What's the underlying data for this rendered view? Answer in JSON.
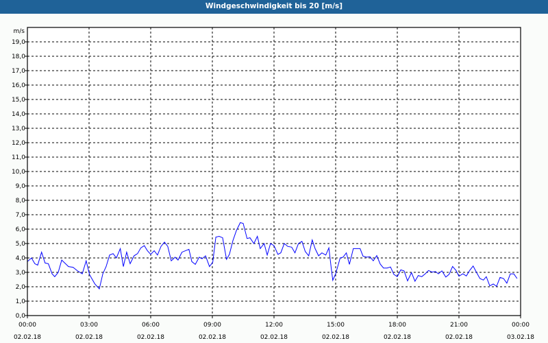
{
  "title": "Windgeschwindigkeit bis 20 [m/s]",
  "colors": {
    "titlebar": "#1f6298",
    "line": "#0000ff"
  },
  "chart_data": {
    "type": "line",
    "title": "Windgeschwindigkeit bis 20 [m/s]",
    "ylabel": "m/s",
    "xlabel": "",
    "ylim": [
      0,
      20
    ],
    "xlim_hours": [
      0,
      24
    ],
    "grid": true,
    "y_ticks": [
      "0,0",
      "1,0",
      "2,0",
      "3,0",
      "4,0",
      "5,0",
      "6,0",
      "7,0",
      "8,0",
      "9,0",
      "10,0",
      "11,0",
      "12,0",
      "13,0",
      "14,0",
      "15,0",
      "16,0",
      "17,0",
      "18,0",
      "19,0"
    ],
    "x_ticks": [
      {
        "time": "00:00",
        "date": "02.02.18"
      },
      {
        "time": "03:00",
        "date": "02.02.18"
      },
      {
        "time": "06:00",
        "date": "02.02.18"
      },
      {
        "time": "09:00",
        "date": "02.02.18"
      },
      {
        "time": "12:00",
        "date": "02.02.18"
      },
      {
        "time": "15:00",
        "date": "02.02.18"
      },
      {
        "time": "18:00",
        "date": "02.02.18"
      },
      {
        "time": "21:00",
        "date": "02.02.18"
      },
      {
        "time": "00:00",
        "date": "03.02.18"
      }
    ],
    "series": [
      {
        "name": "Windgeschwindigkeit",
        "x_hours": [
          0,
          0.2,
          0.36,
          0.5,
          0.69,
          0.86,
          1.02,
          1.2,
          1.33,
          1.5,
          1.67,
          2.0,
          2.22,
          2.44,
          2.67,
          2.86,
          3.02,
          3.28,
          3.5,
          3.67,
          3.83,
          4.0,
          4.17,
          4.33,
          4.52,
          4.67,
          4.83,
          5.0,
          5.19,
          5.36,
          5.52,
          5.69,
          5.84,
          6.0,
          6.17,
          6.33,
          6.5,
          6.67,
          6.83,
          7.0,
          7.19,
          7.33,
          7.52,
          7.86,
          8.0,
          8.17,
          8.36,
          8.5,
          8.67,
          8.86,
          9.02,
          9.17,
          9.33,
          9.5,
          9.69,
          9.83,
          10.0,
          10.17,
          10.36,
          10.5,
          10.69,
          10.83,
          11.02,
          11.19,
          11.33,
          11.52,
          11.67,
          11.83,
          12.0,
          12.19,
          12.33,
          12.5,
          12.67,
          12.86,
          13.02,
          13.19,
          13.36,
          13.52,
          13.69,
          13.86,
          14.0,
          14.17,
          14.33,
          14.52,
          14.67,
          14.78,
          14.86,
          15.0,
          15.22,
          15.36,
          15.52,
          15.67,
          15.86,
          16.19,
          16.33,
          16.5,
          16.67,
          16.83,
          17.0,
          17.17,
          17.33,
          17.5,
          17.67,
          17.83,
          18.0,
          18.17,
          18.33,
          18.5,
          18.69,
          18.86,
          19.02,
          19.19,
          19.36,
          19.52,
          19.69,
          19.86,
          20.0,
          20.17,
          20.36,
          20.52,
          20.69,
          20.86,
          21.0,
          21.19,
          21.36,
          21.52,
          21.69,
          21.86,
          22.02,
          22.19,
          22.33,
          22.5,
          22.67,
          22.83,
          23.0,
          23.17,
          23.33,
          23.5,
          23.67,
          23.83
        ],
        "values": [
          3.75,
          4.0,
          3.6,
          3.5,
          4.4,
          3.65,
          3.6,
          2.9,
          2.7,
          3.0,
          3.85,
          3.4,
          3.35,
          3.1,
          2.9,
          3.8,
          2.85,
          2.2,
          1.85,
          2.9,
          3.4,
          4.2,
          4.3,
          4.0,
          4.65,
          3.4,
          4.4,
          3.6,
          4.15,
          4.3,
          4.7,
          4.85,
          4.5,
          4.25,
          4.5,
          4.2,
          4.8,
          5.1,
          4.8,
          3.8,
          4.05,
          3.85,
          4.4,
          4.6,
          3.75,
          3.55,
          4.05,
          3.95,
          4.15,
          3.4,
          3.7,
          5.45,
          5.5,
          5.4,
          3.9,
          4.25,
          5.2,
          5.9,
          6.45,
          6.4,
          5.35,
          5.4,
          5.0,
          5.5,
          4.65,
          5.0,
          4.2,
          5.0,
          4.85,
          4.25,
          4.35,
          5.0,
          4.8,
          4.75,
          4.35,
          5.0,
          5.15,
          4.45,
          4.15,
          5.25,
          4.65,
          4.15,
          4.35,
          4.2,
          4.7,
          3.35,
          2.45,
          2.9,
          4.0,
          4.05,
          4.35,
          3.55,
          4.65,
          4.65,
          4.13,
          4.05,
          4.08,
          3.8,
          4.16,
          3.57,
          3.3,
          3.3,
          3.37,
          2.86,
          2.7,
          3.17,
          3.1,
          2.41,
          2.98,
          2.38,
          2.78,
          2.7,
          2.9,
          3.13,
          3.02,
          3.05,
          2.9,
          3.1,
          2.67,
          2.86,
          3.41,
          3.13,
          2.73,
          2.9,
          2.75,
          3.13,
          3.44,
          2.98,
          2.57,
          2.46,
          2.7,
          2.06,
          2.19,
          2.03,
          2.65,
          2.57,
          2.25,
          2.89,
          2.89,
          2.57
        ]
      }
    ]
  }
}
